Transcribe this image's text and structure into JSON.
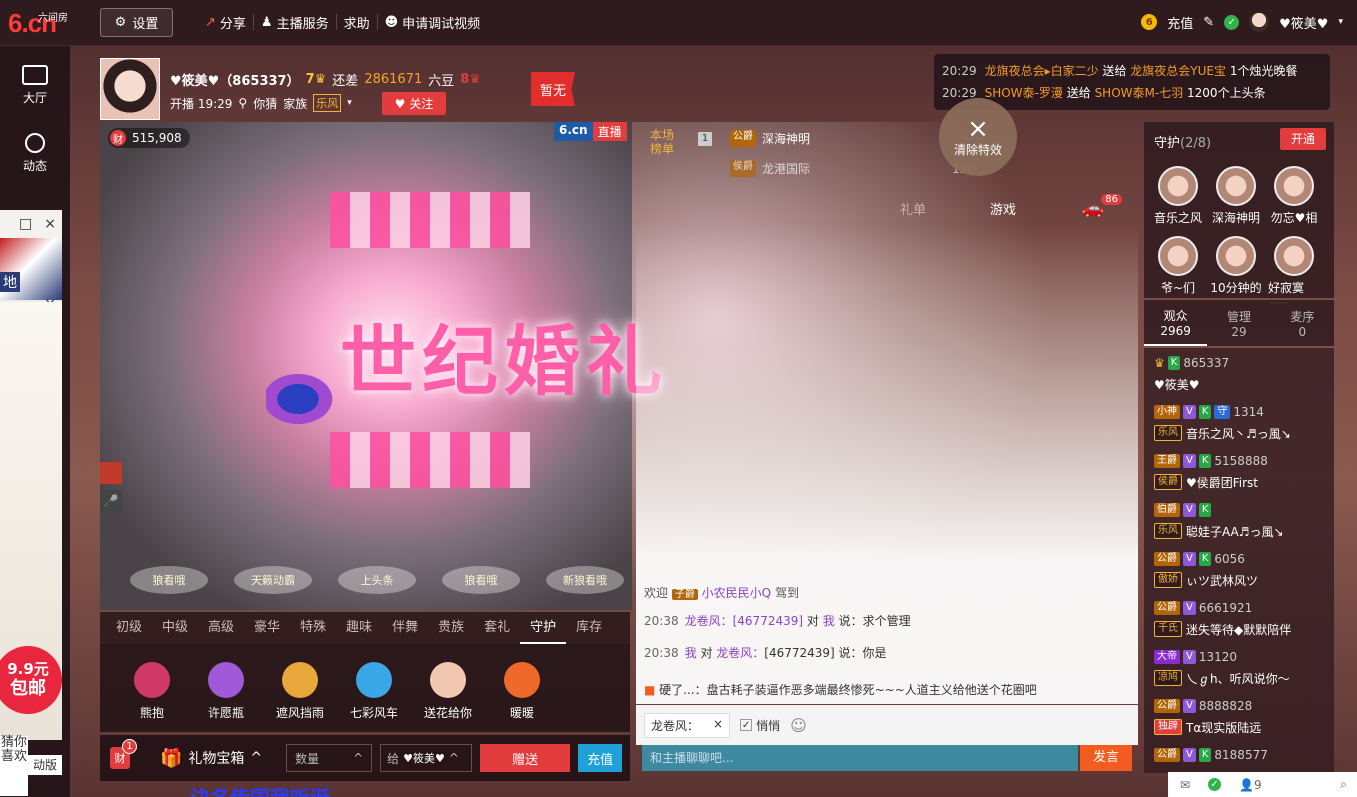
{
  "logo": {
    "big": "6.cn",
    "small": "六间房"
  },
  "topbar": {
    "settings": "设置",
    "nav": [
      "分享",
      "主播服务",
      "求助",
      "申请调试视频"
    ],
    "recharge": "充值",
    "username": "♥筱美♥",
    "coin_icon": "6"
  },
  "sidebar": {
    "items": [
      "大厅",
      "动态"
    ]
  },
  "ad": {
    "price": "9.9元",
    "price_sub": "包邮",
    "guess": "猜你喜欢",
    "guess2": "动版",
    "mark": "地"
  },
  "host": {
    "name": "♥筱美♥（865337）",
    "level": "7",
    "gap_label": "还差",
    "gap_value": "2861671",
    "gap_unit": "六豆",
    "next_level": "8",
    "start_time": "开播 19:29",
    "location": "你猜",
    "family_label": "家族",
    "family": "乐风",
    "follow": "关注",
    "flag": "暂无"
  },
  "video": {
    "wealth_icon": "财",
    "wealth": "515,908",
    "brand": "6.cn",
    "live": "直播",
    "effect_title": "世纪婚礼",
    "stands": [
      "狼看哦",
      "天籁动霸",
      "上头条",
      "狼看哦",
      "新狼看哦"
    ]
  },
  "gift_tabs": [
    "初级",
    "中级",
    "高级",
    "豪华",
    "特殊",
    "趣味",
    "伴舞",
    "贵族",
    "套礼",
    "守护",
    "库存"
  ],
  "gift_tab_active": "守护",
  "gifts": [
    {
      "name": "熊抱",
      "color": "#d03a6a"
    },
    {
      "name": "许愿瓶",
      "color": "#a05ad8"
    },
    {
      "name": "遮风挡雨",
      "color": "#e8a73a"
    },
    {
      "name": "七彩风车",
      "color": "#3aa8e8"
    },
    {
      "name": "送花给你",
      "color": "#f1c7b0"
    },
    {
      "name": "暖暖",
      "color": "#ef6a2a"
    }
  ],
  "giftbar": {
    "cai": "财",
    "cai_count": "1",
    "box": "礼物宝箱",
    "qty_placeholder": "数量",
    "to_label": "给",
    "to_name": "♥筱美♥",
    "send": "赠送",
    "recharge": "充值"
  },
  "banner_bottom": "決名传国我听诞",
  "notice": [
    {
      "time": "20:29",
      "from": "龙旗夜总会▸白家二少",
      "verb": "送给",
      "to": "龙旗夜总会YUE宝",
      "gift": "1个烛光晚餐"
    },
    {
      "time": "20:29",
      "from": "SHOW泰-罗漫",
      "verb": "送给",
      "to": "SHOW泰M-七羽",
      "gift": "1200个上头条"
    }
  ],
  "rank": {
    "label": "本场榜单",
    "num": "1",
    "rows": [
      {
        "badge": "公爵",
        "name": "深海神明"
      },
      {
        "badge": "侯爵",
        "name": "龙港国际"
      }
    ],
    "value": "150"
  },
  "clear_fx": {
    "x": "×",
    "label": "清除特效"
  },
  "chat_tabs": [
    "礼单",
    "游戏"
  ],
  "car_count": "86",
  "chat": {
    "welcome": "欢迎",
    "welcome_badge": "子爵",
    "welcome_user": "小农民民小Q",
    "welcome_tail": "驾到",
    "lines": [
      {
        "time": "20:38",
        "user": "龙卷风：",
        "id": "[46772439]",
        "verb": "对",
        "target": "我",
        "msg": "说：求个管理"
      },
      {
        "time": "20:38",
        "user": "我",
        "id": "",
        "verb": "对",
        "target": "龙卷风：",
        "msg": "[46772439] 说：你是"
      }
    ],
    "system": "硬了...：盘古耗子装逼作恶多端最终惨死~~~人道主义给他送个花圈吧"
  },
  "input": {
    "to": "龙卷风：",
    "close": "×",
    "whisper": "悄悄",
    "placeholder": "和主播聊聊吧...",
    "send": "发言"
  },
  "guard": {
    "title": "守护",
    "count": "(2/8)",
    "open": "开通",
    "members": [
      "音乐之风",
      "深海神明",
      "勿忘♥相",
      "爷~们",
      "10分钟的",
      "好寂寞~~"
    ]
  },
  "aud_tabs": [
    {
      "label": "观众",
      "count": "2969"
    },
    {
      "label": "管理",
      "count": "29"
    },
    {
      "label": "麦序",
      "count": "0"
    }
  ],
  "audience": [
    {
      "badges": [
        "K"
      ],
      "id": "865337",
      "name": "♥筱美♥",
      "noble": "",
      "family": ""
    },
    {
      "noble": "小神",
      "badges": [
        "V",
        "K",
        "守"
      ],
      "id": "1314",
      "family": "乐风",
      "name": "音乐之风丶♬っ風↘"
    },
    {
      "noble": "王爵",
      "badges": [
        "V",
        "K"
      ],
      "id": "5158888",
      "family": "侯爵",
      "name": "♥侯爵团First"
    },
    {
      "noble": "伯爵",
      "badges": [
        "V",
        "K"
      ],
      "id": "",
      "family": "乐风",
      "name": "聪娃子AA♬っ風↘"
    },
    {
      "noble": "公爵",
      "badges": [
        "V",
        "K"
      ],
      "id": "6056",
      "family": "傲娇",
      "name": "ぃツ武林风ツ"
    },
    {
      "noble": "公爵",
      "badges": [
        "V"
      ],
      "id": "6661921",
      "family": "千氏",
      "name": "迷失等待◆默默陪伴"
    },
    {
      "noble": "大帝",
      "badges": [
        "V"
      ],
      "id": "13120",
      "family": "凉鸠",
      "name": "乀ℊh、听风说你～"
    },
    {
      "noble": "公爵",
      "badges": [
        "V"
      ],
      "id": "8888828",
      "family": "独辟",
      "name": "Tα现实版陆远"
    },
    {
      "noble": "公爵",
      "badges": [
        "V",
        "K"
      ],
      "id": "8188577",
      "family": "",
      "name": ""
    }
  ],
  "bottom_right": {
    "count": "9"
  }
}
